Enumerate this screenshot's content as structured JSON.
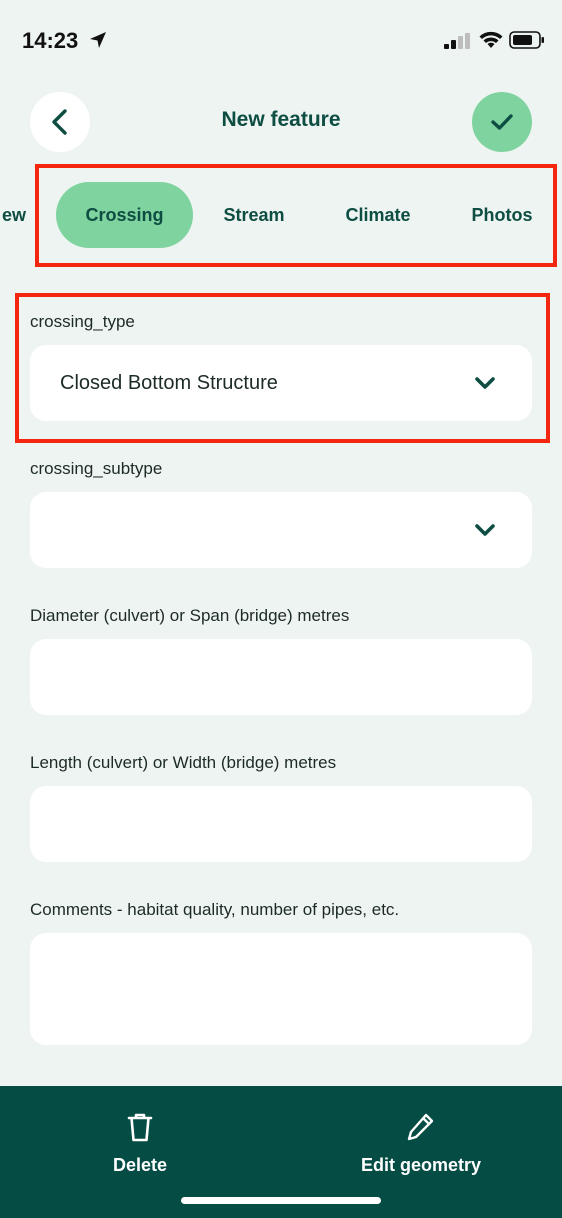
{
  "status_bar": {
    "time": "14:23",
    "icons": [
      "location-arrow-icon",
      "cellular-signal-icon",
      "wifi-icon",
      "battery-icon"
    ]
  },
  "header": {
    "title": "New feature",
    "back_icon": "chevron-left-icon",
    "confirm_icon": "checkmark-icon"
  },
  "tabs": [
    {
      "label": "ew"
    },
    {
      "label": "Crossing",
      "active": true
    },
    {
      "label": "Stream"
    },
    {
      "label": "Climate"
    },
    {
      "label": "Photos"
    }
  ],
  "form": {
    "crossing_type": {
      "label": "crossing_type",
      "value": "Closed Bottom Structure"
    },
    "crossing_subtype": {
      "label": "crossing_subtype",
      "value": ""
    },
    "diameter": {
      "label": "Diameter (culvert) or Span (bridge) metres",
      "value": ""
    },
    "length": {
      "label": "Length (culvert) or Width (bridge) metres",
      "value": ""
    },
    "comments": {
      "label": "Comments - habitat quality,  number of pipes,  etc.",
      "value": ""
    }
  },
  "bottom_bar": {
    "delete_label": "Delete",
    "edit_geometry_label": "Edit geometry",
    "delete_icon": "trash-icon",
    "edit_icon": "pencil-icon"
  },
  "colors": {
    "background": "#eef4f1",
    "accent_green": "#7fd39f",
    "dark_teal": "#054c45",
    "title_text": "#0e4d42",
    "highlight_red": "#f5260f"
  }
}
